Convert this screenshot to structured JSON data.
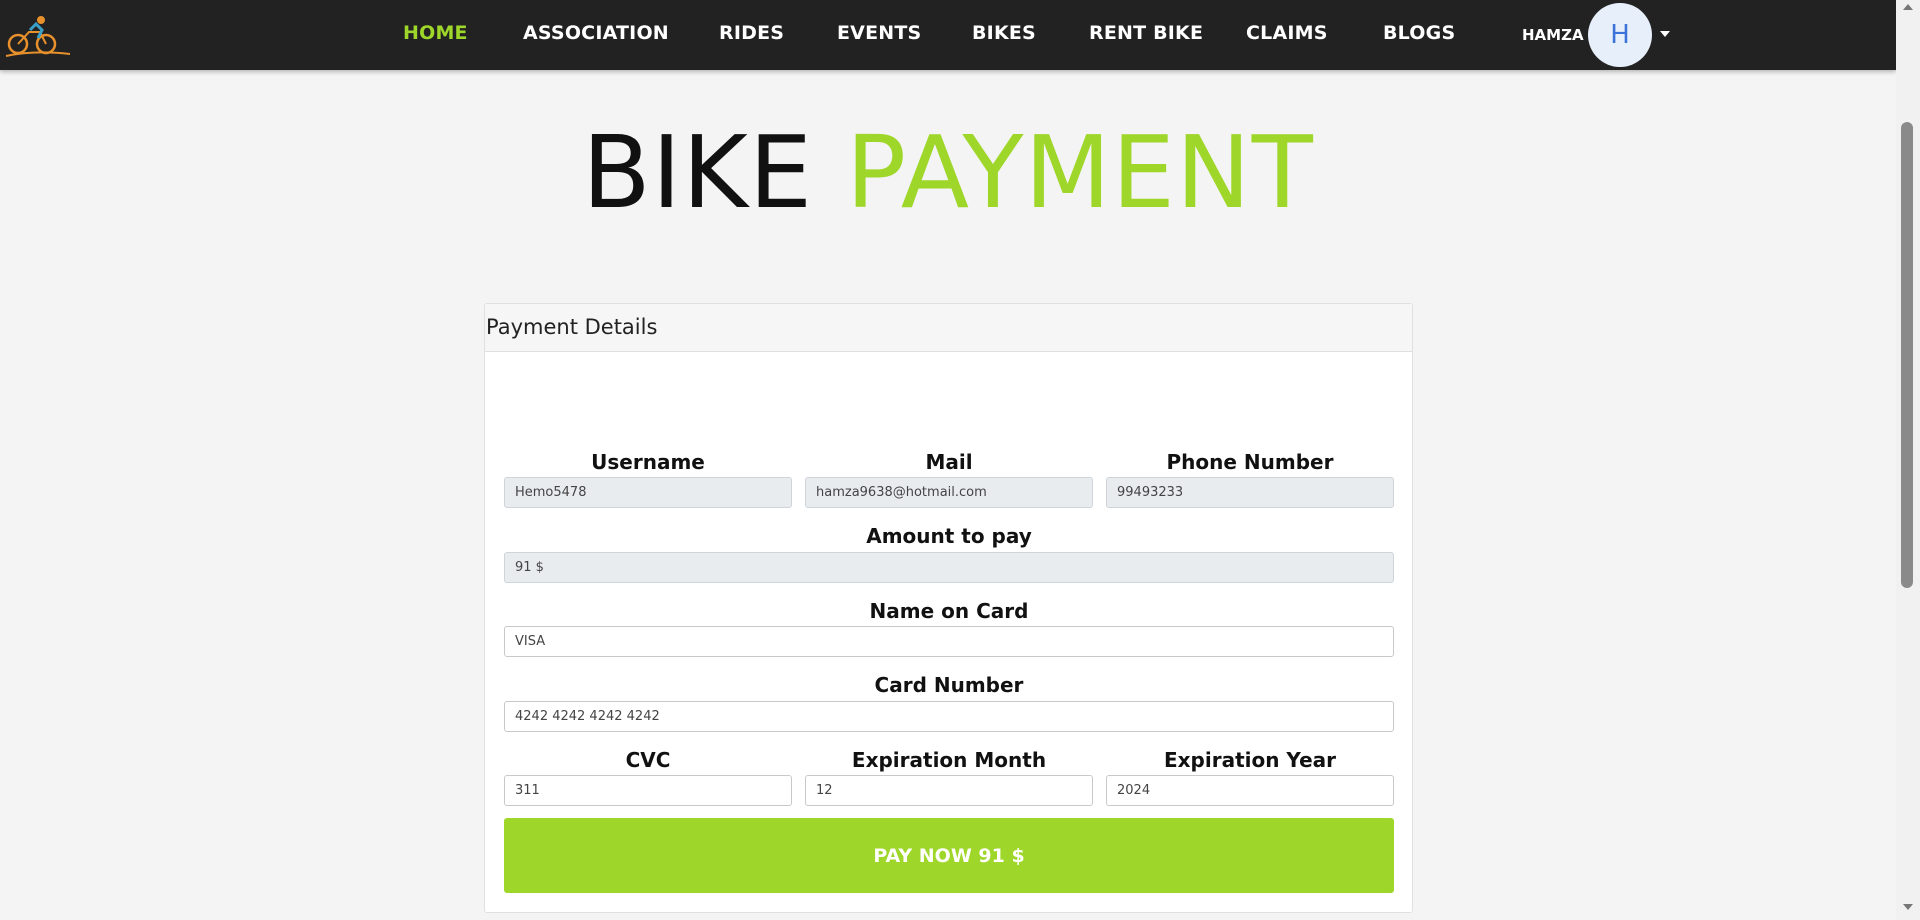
{
  "colors": {
    "accent": "#9fd62a",
    "navbar": "#222222",
    "avatar_bg": "#e7effb",
    "avatar_text": "#3b73d9"
  },
  "nav": {
    "logo_icon": "cyclist-logo-icon",
    "items": [
      "HOME",
      "ASSOCIATION",
      "RIDES",
      "EVENTS",
      "BIKES",
      "RENT BIKE",
      "CLAIMS",
      "BLOGS"
    ],
    "active": "HOME",
    "user_name": "HAMZA",
    "avatar_letter": "H",
    "dropdown_icon": "caret-down-icon"
  },
  "title": {
    "part1": "BIKE",
    "part2": "PAYMENT"
  },
  "form": {
    "header": "Payment Details",
    "username_label": "Username",
    "username_value": "Hemo5478",
    "mail_label": "Mail",
    "mail_value": "hamza9638@hotmail.com",
    "phone_label": "Phone Number",
    "phone_value": "99493233",
    "amount_label": "Amount to pay",
    "amount_value": "91 $",
    "name_label": "Name on Card",
    "name_value": "VISA",
    "card_label": "Card Number",
    "card_value": "4242 4242 4242 4242",
    "cvc_label": "CVC",
    "cvc_value": "311",
    "month_label": "Expiration Month",
    "month_value": "12",
    "year_label": "Expiration Year",
    "year_value": "2024",
    "pay_button": "PAY NOW 91 $"
  }
}
